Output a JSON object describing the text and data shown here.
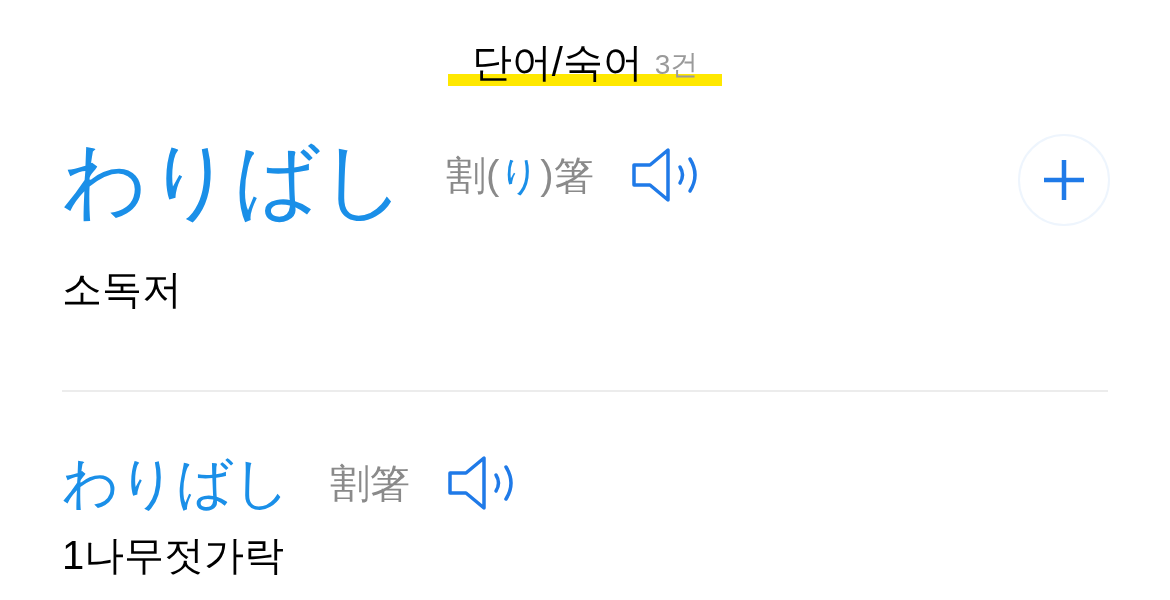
{
  "section": {
    "title": "단어/숙어",
    "count": "3건"
  },
  "entries": [
    {
      "headword": "わりばし",
      "kanji": [
        {
          "text": "割(",
          "kind": "kanji"
        },
        {
          "text": "り",
          "kind": "kana"
        },
        {
          "text": ")箸",
          "kind": "kanji"
        }
      ],
      "meaning": "소독저",
      "add_button": true
    },
    {
      "headword": "わりばし",
      "kanji": [
        {
          "text": "割箸",
          "kind": "kanji"
        }
      ],
      "meaning": "1나무젓가락",
      "add_button": false
    }
  ]
}
